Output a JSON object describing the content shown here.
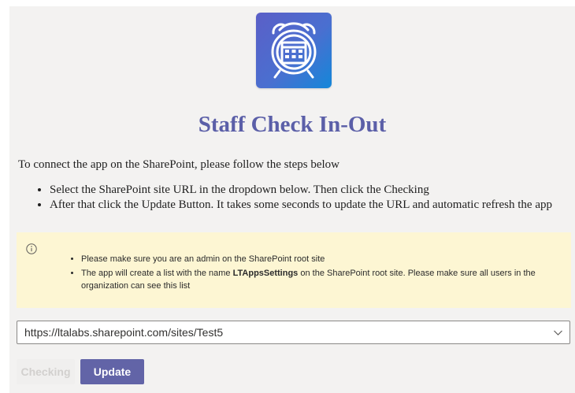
{
  "app": {
    "title": "Staff Check In-Out",
    "logo_icon": "alarm-clock-calendar-icon"
  },
  "intro": "To connect the app on the SharePoint, please follow the steps below",
  "steps": [
    "Select the SharePoint site URL in the dropdown below. Then click the Checking",
    "After that click the Update Button. It takes some seconds to update the URL and automatic refresh the app"
  ],
  "notice": {
    "icon": "info-icon",
    "items": [
      {
        "text": "Please make sure you are an admin on the SharePoint root site"
      },
      {
        "before": "The app will create a list with the name ",
        "bold": "LTAppsSettings",
        "after": " on the SharePoint root site. Please make sure all users in the organization can see this list"
      }
    ]
  },
  "site_select": {
    "value": "https://ltalabs.sharepoint.com/sites/Test5",
    "icon": "chevron-down-icon"
  },
  "buttons": {
    "checking": "Checking",
    "update": "Update"
  },
  "colors": {
    "accent": "#6264a7",
    "title": "#5b5fa8",
    "notice_bg": "#fdf6d3",
    "panel_bg": "#f3f2f1"
  }
}
